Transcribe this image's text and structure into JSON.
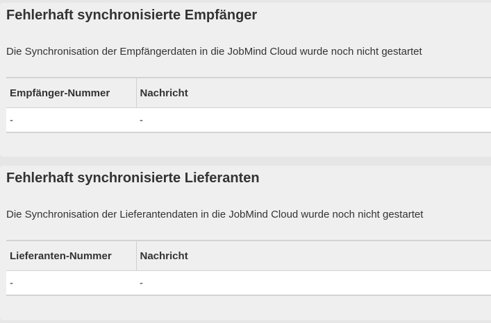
{
  "sections": [
    {
      "title": "Fehlerhaft synchronisierte Empfänger",
      "description": "Die Synchronisation der Empfängerdaten in die JobMind Cloud wurde noch nicht gestartet",
      "columns": [
        "Empfänger-Nummer",
        "Nachricht"
      ],
      "rows": [
        [
          "-",
          "-"
        ]
      ]
    },
    {
      "title": "Fehlerhaft synchronisierte Lieferanten",
      "description": "Die Synchronisation der Lieferantendaten in die JobMind Cloud wurde noch nicht gestartet",
      "columns": [
        "Lieferanten-Nummer",
        "Nachricht"
      ],
      "rows": [
        [
          "-",
          "-"
        ]
      ]
    }
  ]
}
